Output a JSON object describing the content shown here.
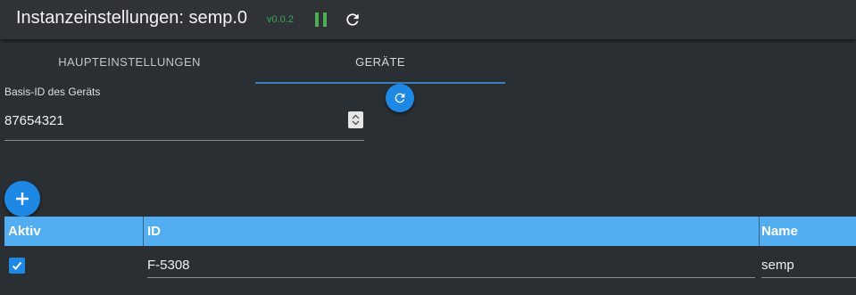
{
  "header": {
    "title": "Instanzeinstellungen: semp.0",
    "version": "v0.0.2",
    "pause_icon": "pause-icon",
    "reload_icon": "reload-icon"
  },
  "tabs": [
    {
      "label": "HAUPTEINSTELLUNGEN",
      "active": false
    },
    {
      "label": "GERÄTE",
      "active": true
    }
  ],
  "form": {
    "base_id": {
      "label": "Basis-ID des Geräts",
      "value": "87654321"
    }
  },
  "table": {
    "columns": [
      "Aktiv",
      "ID",
      "Name"
    ],
    "rows": [
      {
        "active": true,
        "id": "F-5308",
        "name": "semp"
      }
    ]
  },
  "colors": {
    "accent": "#1e88e5",
    "table_header": "#52aef0",
    "background": "#2a2f33",
    "status_green": "#4caf50"
  }
}
